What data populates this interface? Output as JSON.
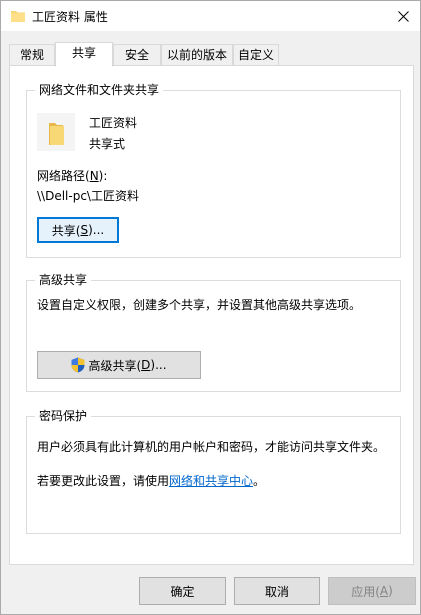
{
  "window": {
    "title": "工匠资料 属性",
    "close_symbol": "✕"
  },
  "tabs": [
    {
      "label": "常规"
    },
    {
      "label": "共享"
    },
    {
      "label": "安全"
    },
    {
      "label": "以前的版本"
    },
    {
      "label": "自定义"
    }
  ],
  "network_sharing": {
    "group_title": "网络文件和文件夹共享",
    "folder_name": "工匠资料",
    "share_status": "共享式",
    "path_label_prefix": "网络路径(",
    "path_label_key": "N",
    "path_label_suffix": "):",
    "path_value": "\\\\Dell-pc\\工匠资料",
    "share_button_prefix": "共享(",
    "share_button_key": "S",
    "share_button_suffix": ")..."
  },
  "advanced_sharing": {
    "group_title": "高级共享",
    "description": "设置自定义权限，创建多个共享，并设置其他高级共享选项。",
    "button_prefix": "高级共享(",
    "button_key": "D",
    "button_suffix": ")..."
  },
  "password_protection": {
    "group_title": "密码保护",
    "description": "用户必须具有此计算机的用户帐户和密码，才能访问共享文件夹。",
    "change_prefix": "若要更改此设置，请使用",
    "change_link": "网络和共享中心",
    "change_suffix": "。"
  },
  "footer": {
    "ok_label": "确定",
    "cancel_label": "取消",
    "apply_prefix": "应用(",
    "apply_key": "A",
    "apply_suffix": ")"
  },
  "colors": {
    "accent": "#0078d7",
    "link": "#0066cc",
    "folder": "#f8d775"
  }
}
